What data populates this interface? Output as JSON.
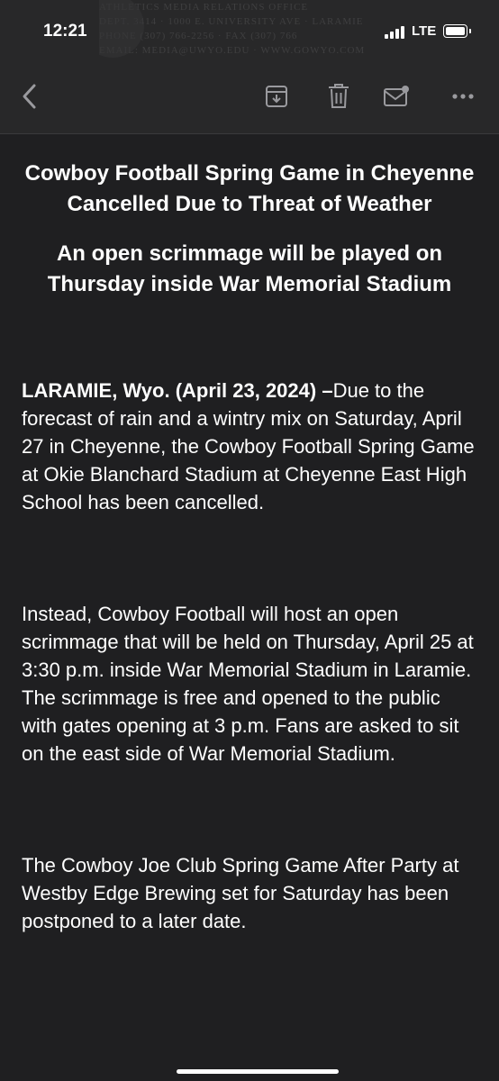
{
  "status_bar": {
    "time": "12:21",
    "network": "LTE"
  },
  "letterhead": {
    "lines": [
      "ATHLETICS MEDIA RELATIONS OFFICE",
      "DEPT. 3414 · 1000 E. UNIVERSITY AVE · LARAMIE",
      "PHONE (307) 766-2256 · FAX (307) 766",
      "EMAIL: MEDIA@UWYO.EDU · WWW.GOWYO.COM"
    ]
  },
  "toolbar": {
    "icons": [
      "back-icon",
      "archive-icon",
      "trash-icon",
      "mail-unread-icon",
      "more-icon"
    ]
  },
  "email": {
    "headline": "Cowboy Football Spring Game in Cheyenne Cancelled Due to Threat of Weather",
    "subheadline": "An open scrimmage will be played on Thursday inside War Memorial Stadium",
    "dateline": "LARAMIE, Wyo.  (April 23, 2024) –",
    "paragraph1_rest": "Due to the forecast of rain and a wintry mix on Saturday, April 27 in Cheyenne, the Cowboy Football Spring Game at Okie Blanchard Stadium at Cheyenne East High School has been cancelled.",
    "paragraph2": "Instead, Cowboy Football will host an open scrimmage that will be held on Thursday, April 25 at 3:30 p.m. inside War Memorial Stadium in Laramie. The scrimmage is free and opened to the public with gates opening at 3 p.m. Fans are asked to sit on the east side of War Memorial Stadium.",
    "paragraph3": "The Cowboy Joe Club Spring Game After Party at Westby Edge Brewing set for Saturday has been postponed to a later date."
  },
  "colors": {
    "background": "#1f1f21",
    "toolbar_bg": "#282829",
    "icon": "#9a9a9e",
    "text": "#ffffff"
  }
}
